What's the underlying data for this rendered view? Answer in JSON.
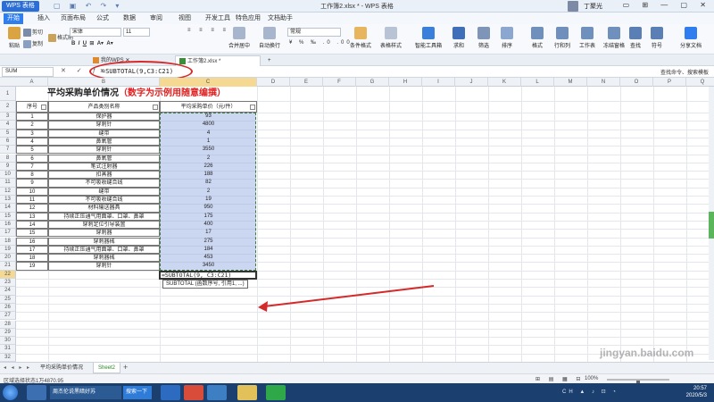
{
  "titlebar": {
    "app_name": "WPS 表格",
    "document_title": "工作簿2.xlsx * - WPS 表格",
    "user_name": "丁聚光"
  },
  "menu_tabs": [
    "开始",
    "插入",
    "页面布局",
    "公式",
    "数据",
    "审阅",
    "视图",
    "开发工具",
    "特色应用",
    "文档助手"
  ],
  "ribbon": {
    "paste": "粘贴",
    "cut": "剪切",
    "copy": "复制",
    "format_painter": "格式刷",
    "font_name": "宋体",
    "font_size": "11",
    "number_format": "常规",
    "merge_center": "合并居中",
    "auto_wrap": "自动换行",
    "conditional_format": "条件格式",
    "table_style": "表格样式",
    "smart_toolbox": "智能工具箱",
    "sum": "求和",
    "filter": "筛选",
    "sort": "排序",
    "format": "格式",
    "row_col": "行和列",
    "worksheet": "工作表",
    "freeze": "冻结窗格",
    "find": "查找",
    "symbol": "符号",
    "share": "分享文档"
  },
  "doc_tabs": [
    {
      "label": "我的WPS",
      "active": false
    },
    {
      "label": "工作簿2.xlsx *",
      "active": true
    }
  ],
  "formula_bar": {
    "name_box": "SUM",
    "formula": "=SUBTOTAL(9,C3:C21)",
    "search_cmd": "查找命令、搜索模板"
  },
  "columns": [
    "A",
    "B",
    "C",
    "D",
    "E",
    "F",
    "G",
    "H",
    "I",
    "J",
    "K",
    "L",
    "M",
    "N",
    "O",
    "P",
    "Q"
  ],
  "selected_column": "C",
  "rows": [
    "1",
    "2",
    "3",
    "4",
    "5",
    "6",
    "7",
    "8",
    "9",
    "10",
    "11",
    "12",
    "13",
    "14",
    "15",
    "16",
    "17",
    "18",
    "19",
    "20",
    "21",
    "22",
    "23",
    "24",
    "25",
    "26",
    "27",
    "28",
    "29",
    "30",
    "31",
    "32"
  ],
  "selected_row": "22",
  "table": {
    "title_black": "平均采购单价情况",
    "title_red": "（数字为示例用随意编撰）",
    "headers": [
      "序号",
      "产品类别名称",
      "平均采购单价（元/件）"
    ],
    "records": [
      [
        "1",
        "保护器",
        "93"
      ],
      [
        "2",
        "穿刺针",
        "4800"
      ],
      [
        "3",
        "缝带",
        "4"
      ],
      [
        "4",
        "鼻氧管",
        "1"
      ],
      [
        "5",
        "穿刺针",
        "3550"
      ],
      [
        "6",
        "鼻氧管",
        "2"
      ],
      [
        "7",
        "笔式注射器",
        "226"
      ],
      [
        "8",
        "扣蒸器",
        "188"
      ],
      [
        "9",
        "不可吸收缝合线",
        "82"
      ],
      [
        "10",
        "缝带",
        "2"
      ],
      [
        "11",
        "不可吸收缝合线",
        "19"
      ],
      [
        "12",
        "材料输送器具",
        "950"
      ],
      [
        "13",
        "持续正压通气用面罩、口罩、鼻罩",
        "175"
      ],
      [
        "14",
        "穿刺定位引导装置",
        "400"
      ],
      [
        "15",
        "穿刺器",
        "17"
      ],
      [
        "16",
        "穿刺器械",
        "275"
      ],
      [
        "17",
        "持续正压通气用面罩、口罩、鼻罩",
        "184"
      ],
      [
        "18",
        "穿刺器械",
        "453"
      ],
      [
        "19",
        "穿刺针",
        "3450"
      ]
    ]
  },
  "active_cell_formula": "=SUBTOTAL(9, C3:C21)",
  "tooltip": "SUBTOTAL (函数序号, 引用1, ...)",
  "sheets": [
    {
      "label": "平均采购单价情况",
      "active": false
    },
    {
      "label": "Sheet2",
      "active": true
    }
  ],
  "status": {
    "mode": "区域选择状态",
    "summary": "1万4870.95",
    "zoom": "100%"
  },
  "taskbar": {
    "item1": "周杰伦说黑暗好苏",
    "search_btn": "搜索一下",
    "time": "20:57",
    "date": "2020/5/3",
    "input": "CH"
  },
  "watermark": "jingyan.baidu.com",
  "colors": {
    "accent": "#2e7ef0",
    "selection_fill": "#b4c4ee",
    "title_red": "#e02020",
    "annotation_red": "#d42a2a",
    "taskbar": "#1b3f6e"
  }
}
